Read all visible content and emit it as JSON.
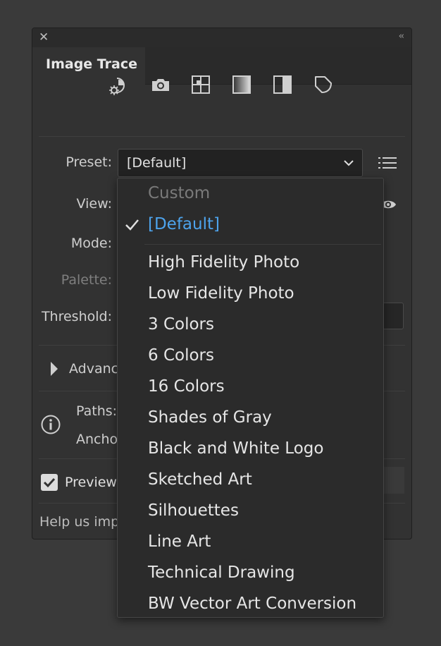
{
  "panel": {
    "title": "Image Trace",
    "close_glyph": "✕",
    "collapse_glyph": "‹‹"
  },
  "icons": [
    "auto-color-icon",
    "high-color-camera-icon",
    "low-color-grid-icon",
    "grayscale-gradient-icon",
    "black-and-white-icon",
    "outline-shape-icon"
  ],
  "labels": {
    "preset": "Preset:",
    "view": "View:",
    "mode": "Mode:",
    "palette": "Palette:",
    "threshold": "Threshold:",
    "advanced": "Advanc",
    "paths": "Paths:",
    "anchors": "Ancho",
    "preview": "Preview",
    "help": "Help us imp"
  },
  "preset": {
    "value": "[Default]",
    "options": [
      {
        "label": "Custom",
        "state": "disabled"
      },
      {
        "label": "[Default]",
        "state": "selected"
      },
      {
        "label": "High Fidelity Photo",
        "state": "normal"
      },
      {
        "label": "Low Fidelity Photo",
        "state": "normal"
      },
      {
        "label": "3 Colors",
        "state": "normal"
      },
      {
        "label": "6 Colors",
        "state": "normal"
      },
      {
        "label": "16 Colors",
        "state": "normal"
      },
      {
        "label": "Shades of Gray",
        "state": "normal"
      },
      {
        "label": "Black and White Logo",
        "state": "normal"
      },
      {
        "label": "Sketched Art",
        "state": "normal"
      },
      {
        "label": "Silhouettes",
        "state": "normal"
      },
      {
        "label": "Line Art",
        "state": "normal"
      },
      {
        "label": "Technical Drawing",
        "state": "normal"
      },
      {
        "label": "BW Vector Art Conversion",
        "state": "normal"
      }
    ]
  },
  "preview_checked": true,
  "colors": {
    "panel_bg": "#323232",
    "selected_text": "#4da3ec",
    "disabled_text": "#7a7a7a"
  }
}
